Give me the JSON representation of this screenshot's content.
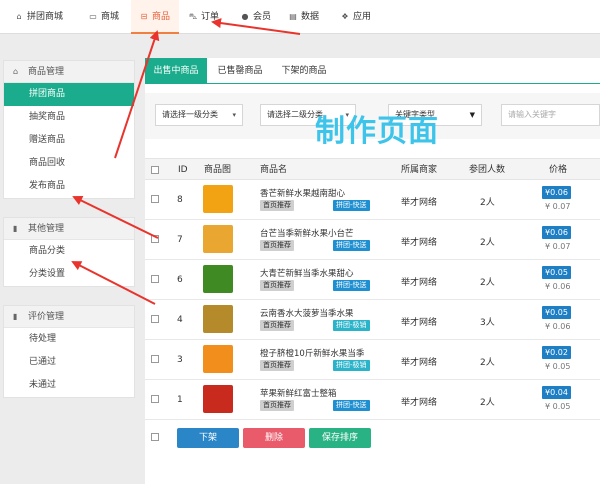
{
  "topnav": {
    "items": [
      {
        "label": "拼团商城",
        "icon": "home-icon",
        "glyph": "⌂"
      },
      {
        "label": "商城",
        "icon": "monitor-icon",
        "glyph": "▭"
      },
      {
        "label": "商品",
        "icon": "gift-icon",
        "glyph": "⊟"
      },
      {
        "label": "订单",
        "icon": "cart-icon",
        "glyph": "⛍"
      },
      {
        "label": "会员",
        "icon": "user-icon",
        "glyph": "●"
      },
      {
        "label": "数据",
        "icon": "chart-icon",
        "glyph": "▤"
      },
      {
        "label": "应用",
        "icon": "cubes-icon",
        "glyph": "❖"
      }
    ],
    "active_color": "#e8623a"
  },
  "sidebar": {
    "goods": {
      "title": "商品管理",
      "items": [
        "拼团商品",
        "抽奖商品",
        "赠送商品",
        "商品回收",
        "发布商品"
      ]
    },
    "other": {
      "title": "其他管理",
      "items": [
        "商品分类",
        "分类设置"
      ]
    },
    "review": {
      "title": "评价管理",
      "items": [
        "待处理",
        "已通过",
        "未通过"
      ]
    },
    "active_color": "#1aac8c"
  },
  "tabs": [
    "出售中商品",
    "已售罄商品",
    "下架的商品"
  ],
  "filters": {
    "level1": "请选择一级分类",
    "level2": "请选择二级分类",
    "keyword_type": "关键字类型",
    "search_placeholder": "请输入关键字"
  },
  "watermark": "制作页面",
  "table": {
    "headers": {
      "id": "ID",
      "image": "商品图",
      "name": "商品名",
      "merchant": "所属商家",
      "joined": "参团人数",
      "price": "价格"
    },
    "rows": [
      {
        "id": "8",
        "name": "香芒新鲜水果越南甜心",
        "tag1": "首页推荐",
        "tag2": "拼团-快送",
        "merchant": "举才网络",
        "joined": "2人",
        "price": "¥0.06",
        "orig": "¥ 0.07",
        "img_color": "#f2a313"
      },
      {
        "id": "7",
        "name": "台芒当季新鲜水果小台芒",
        "tag1": "首页推荐",
        "tag2": "拼团-快送",
        "merchant": "举才网络",
        "joined": "2人",
        "price": "¥0.06",
        "orig": "¥ 0.07",
        "img_color": "#e9a630"
      },
      {
        "id": "6",
        "name": "大青芒新鲜当季水果甜心",
        "tag1": "首页推荐",
        "tag2": "拼团-快送",
        "merchant": "举才网络",
        "joined": "2人",
        "price": "¥0.05",
        "orig": "¥ 0.06",
        "img_color": "#3f8a23"
      },
      {
        "id": "4",
        "name": "云南香水大菠萝当季水果",
        "tag1": "首页推荐",
        "tag2": "拼团-极销",
        "merchant": "举才网络",
        "joined": "3人",
        "price": "¥0.05",
        "orig": "¥ 0.06",
        "img_color": "#b58a2a"
      },
      {
        "id": "3",
        "name": "橙子脐橙10斤新鲜水果当季",
        "tag1": "首页推荐",
        "tag2": "拼团-极销",
        "merchant": "举才网络",
        "joined": "2人",
        "price": "¥0.02",
        "orig": "¥ 0.05",
        "img_color": "#f28e1c"
      },
      {
        "id": "1",
        "name": "苹果新鲜红富士整箱",
        "tag1": "首页推荐",
        "tag2": "拼团-快送",
        "merchant": "举才网络",
        "joined": "2人",
        "price": "¥0.04",
        "orig": "¥ 0.05",
        "img_color": "#c92a1e"
      }
    ]
  },
  "actions": {
    "offline": "下架",
    "delete": "删除",
    "save_order": "保存排序"
  },
  "colors": {
    "offline": "#2b86c8",
    "delete": "#e95a6a",
    "save": "#29b384",
    "arrow": "#e8342c"
  }
}
